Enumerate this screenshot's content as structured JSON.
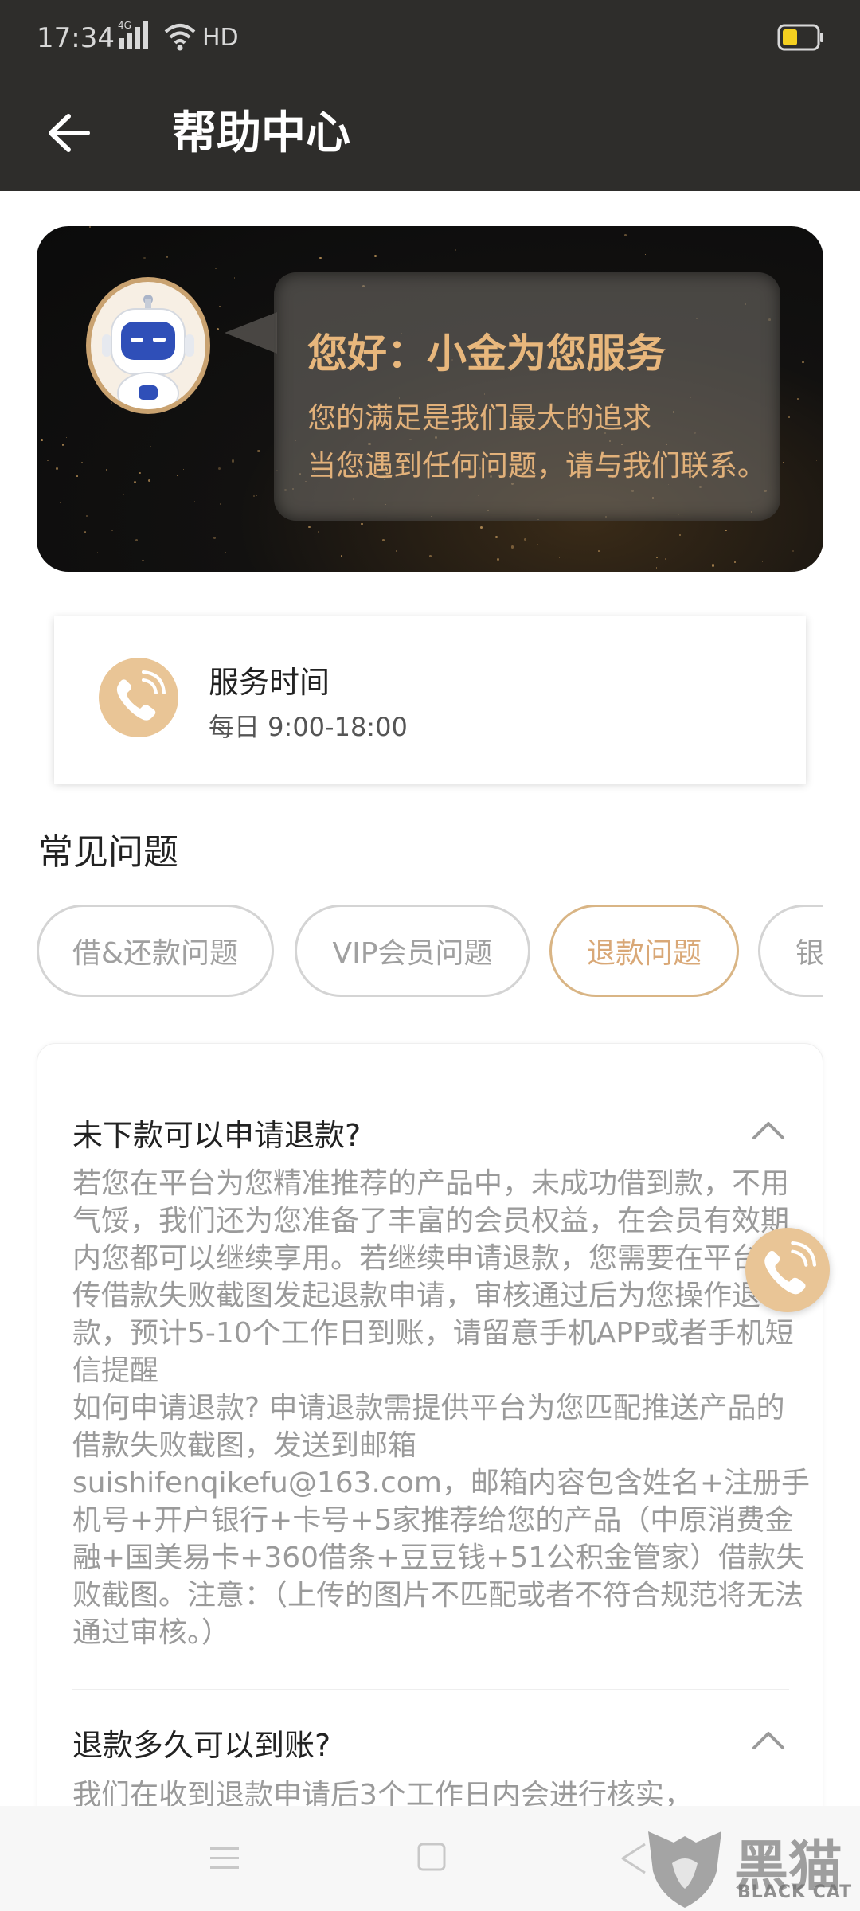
{
  "status_bar": {
    "time": "17:34",
    "network": "4G",
    "hd": "HD",
    "battery_color": "#f5d020"
  },
  "app_bar": {
    "title": "帮助中心",
    "back_icon": "arrow-left-icon"
  },
  "banner": {
    "greeting": "您好：小金为您服务",
    "line1": "您的满足是我们最大的追求",
    "line2": "当您遇到任何问题，请与我们联系。",
    "avatar_icon": "robot-avatar-icon"
  },
  "service": {
    "title": "服务时间",
    "hours": "每日 9:00-18:00",
    "icon": "phone-icon"
  },
  "faq": {
    "heading": "常见问题",
    "tabs": [
      {
        "label": "借&还款问题"
      },
      {
        "label": "VIP会员问题"
      },
      {
        "label": "退款问题",
        "active": true
      },
      {
        "label": "银"
      }
    ],
    "items": [
      {
        "question": "未下款可以申请退款?",
        "answer": "若您在平台为您精准推荐的产品中，未成功借到款，不用气馁，我们还为您准备了丰富的会员权益，在会员有效期内您都可以继续享用。若继续申请退款，您需要在平台上传借款失败截图发起退款申请，审核通过后为您操作退款，预计5-10个工作日到账，请留意手机APP或者手机短信提醒\n如何申请退款? 申请退款需提供平台为您匹配推送产品的借款失败截图，发送到邮箱suishifenqikefu@163.com，邮箱内容包含姓名+注册手机号+开户银行+卡号+5家推荐给您的产品（中原消费金融+国美易卡+360借条+豆豆钱+51公积金管家）借款失败截图。注意：（上传的图片不匹配或者不符合规范将无法通过审核。）"
      },
      {
        "question": "退款多久可以到账?",
        "answer": "我们在收到退款申请后3个工作日内会进行核实，"
      }
    ]
  },
  "colors": {
    "header_bg": "#2e2d2b",
    "gold_accent": "#d9a877",
    "icon_gold": "#e9c596"
  },
  "watermark": {
    "cn": "黑猫",
    "en": "BLACK CAT"
  }
}
